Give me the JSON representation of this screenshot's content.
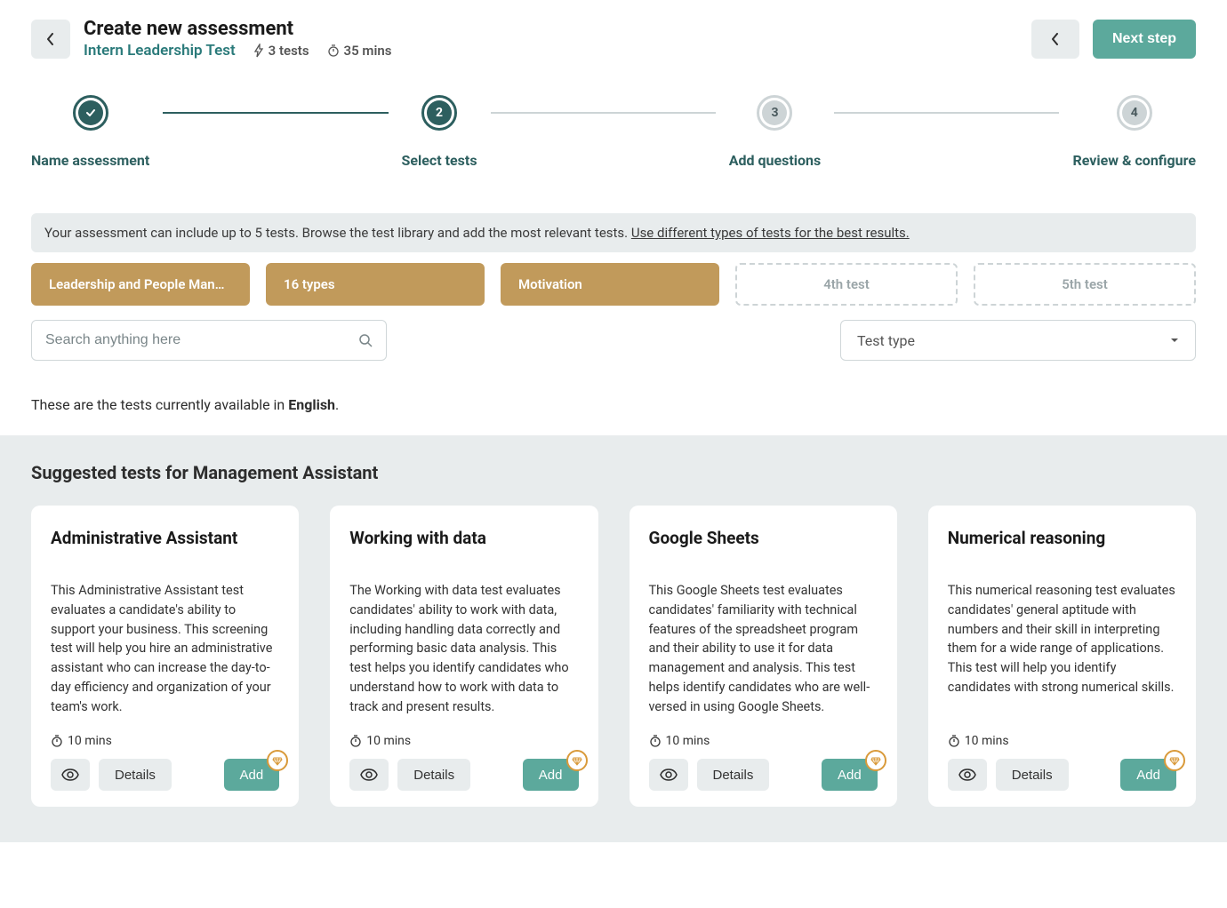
{
  "header": {
    "title": "Create new assessment",
    "assessment_name": "Intern Leadership Test",
    "tests_count": "3 tests",
    "duration": "35 mins",
    "next_label": "Next step"
  },
  "steps": [
    {
      "label": "Name assessment"
    },
    {
      "label": "Select tests",
      "num": "2"
    },
    {
      "label": "Add questions",
      "num": "3"
    },
    {
      "label": "Review & configure",
      "num": "4"
    }
  ],
  "info": {
    "text": "Your assessment can include up to 5 tests. Browse the test library and add the most relevant tests. ",
    "link": "Use different types of tests for the best results."
  },
  "slots": [
    {
      "label": "Leadership and People Man…",
      "filled": true
    },
    {
      "label": "16 types",
      "filled": true
    },
    {
      "label": "Motivation",
      "filled": true
    },
    {
      "label": "4th test",
      "filled": false
    },
    {
      "label": "5th test",
      "filled": false
    }
  ],
  "search": {
    "placeholder": "Search anything here"
  },
  "test_type_label": "Test type",
  "lang_prefix": "These are the tests currently available in ",
  "lang": "English",
  "suggested_title": "Suggested tests for Management Assistant",
  "card_labels": {
    "details": "Details",
    "add": "Add"
  },
  "cards": [
    {
      "title": "Administrative Assistant",
      "desc": "This Administrative Assistant test evaluates a candidate's ability to support your business. This screening test will help you hire an administrative assistant who can increase the day-to-day efficiency and organization of your team's work.",
      "time": "10 mins"
    },
    {
      "title": "Working with data",
      "desc": "The Working with data test evaluates candidates' ability to work with data, including handling data correctly and performing basic data analysis. This test helps you identify candidates who understand how to work with data to track and present results.",
      "time": "10 mins"
    },
    {
      "title": "Google Sheets",
      "desc": "This Google Sheets test evaluates candidates' familiarity with technical features of the spreadsheet program and their ability to use it for data management and analysis. This test helps identify candidates who are well-versed in using Google Sheets.",
      "time": "10 mins"
    },
    {
      "title": "Numerical reasoning",
      "desc": "This numerical reasoning test evaluates candidates' general aptitude with numbers and their skill in interpreting them for a wide range of applications. This test will help you identify candidates with strong numerical skills.",
      "time": "10 mins"
    }
  ]
}
